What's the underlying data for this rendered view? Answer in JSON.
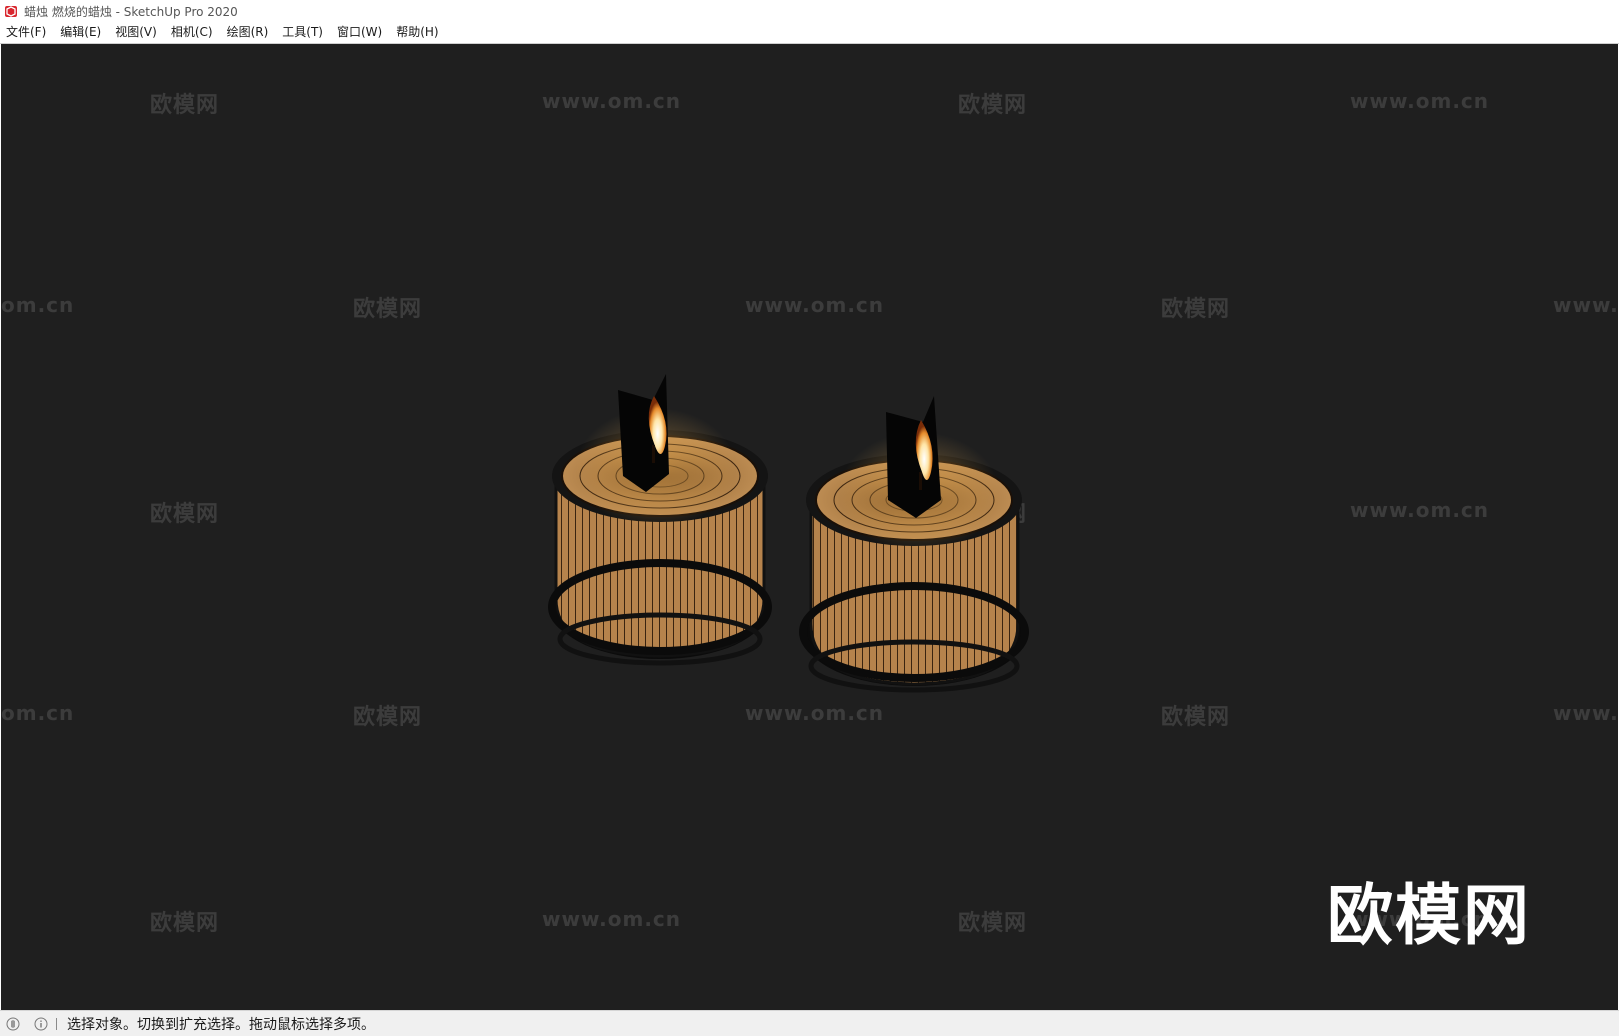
{
  "window": {
    "title": "蜡烛 燃烧的蜡烛 - SketchUp Pro 2020",
    "app_icon": "sketchup-logo-icon"
  },
  "menubar": {
    "items": [
      {
        "label": "文件(F)"
      },
      {
        "label": "编辑(E)"
      },
      {
        "label": "视图(V)"
      },
      {
        "label": "相机(C)"
      },
      {
        "label": "绘图(R)"
      },
      {
        "label": "工具(T)"
      },
      {
        "label": "窗口(W)"
      },
      {
        "label": "帮助(H)"
      }
    ]
  },
  "viewport": {
    "background": "#1f1f1f",
    "model": "two lit candles with wireframe edges",
    "candle_color": "#b0804a",
    "flame_color": "#ffd27a"
  },
  "watermarks": {
    "brand": "欧模网",
    "url": "www.om.cn",
    "url_fragment_start": "om.cn",
    "url_fragment_end": "www."
  },
  "statusbar": {
    "icons": [
      "geo-location-icon",
      "info-icon"
    ],
    "text": "选择对象。切换到扩充选择。拖动鼠标选择多项。"
  }
}
